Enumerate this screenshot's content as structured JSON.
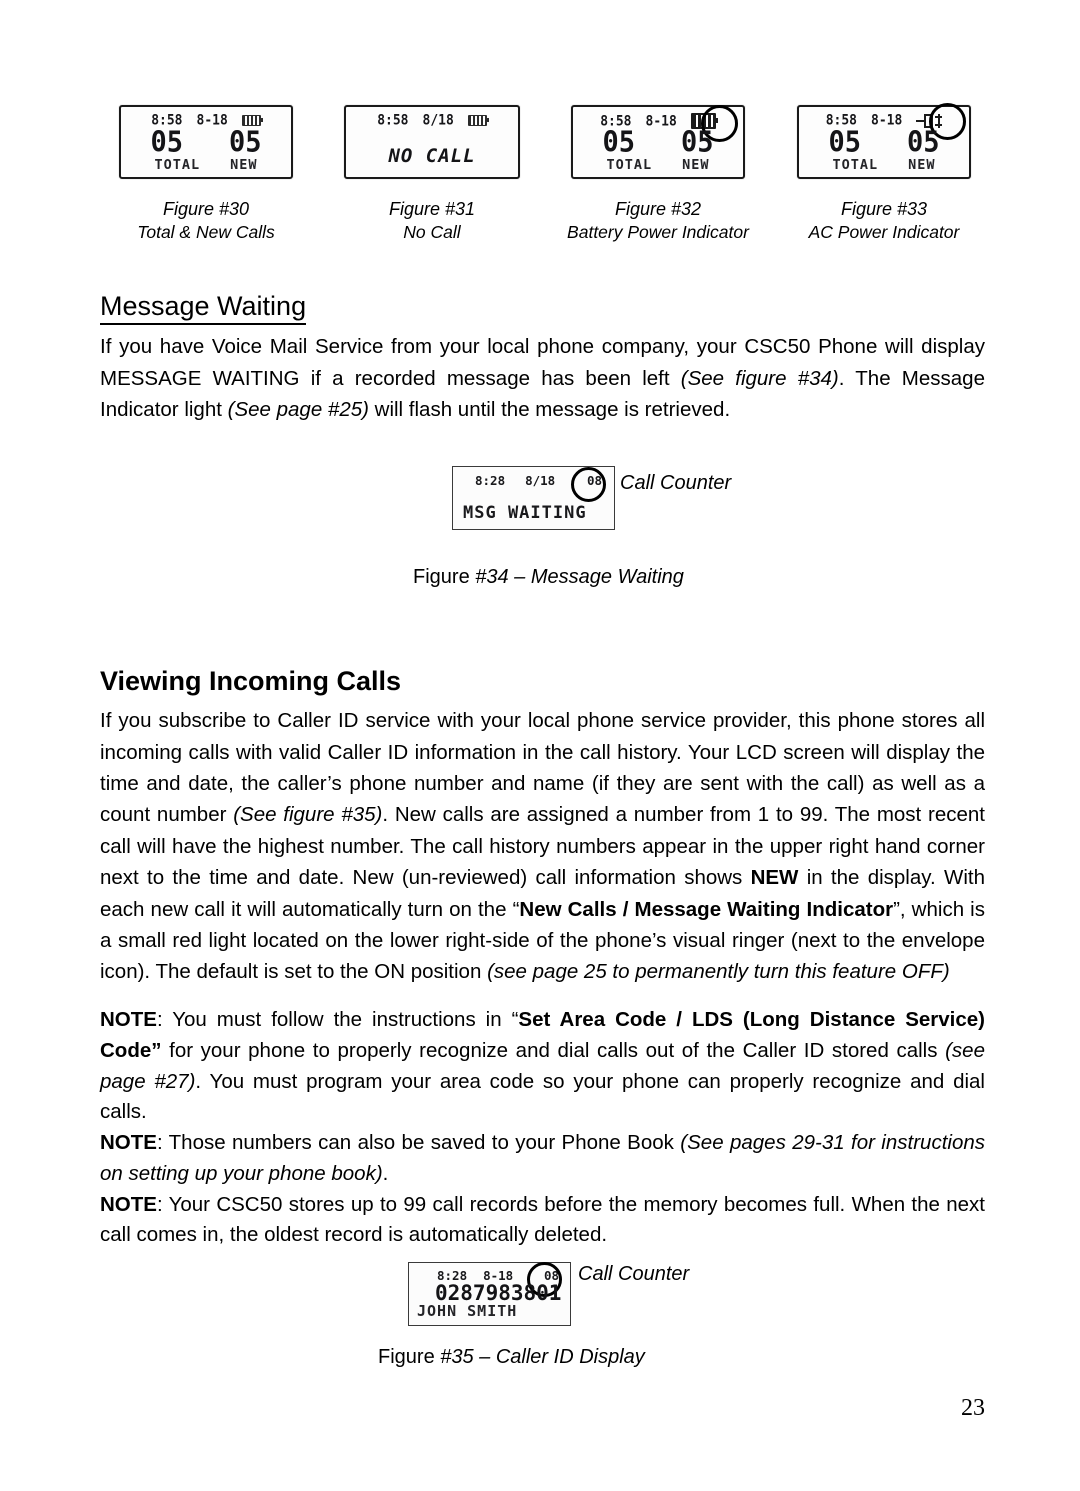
{
  "page": {
    "number": "23"
  },
  "figures_row": [
    {
      "lcd": {
        "time": "8:58",
        "date": "8-18",
        "indicator": "battery-mini-icon",
        "total_value": "05",
        "new_value": "05",
        "total_label": "TOTAL",
        "new_label": "NEW"
      },
      "caption_title": "Figure  #30",
      "caption_sub": "Total & New Calls"
    },
    {
      "lcd": {
        "time": "8:58",
        "date": "8/18",
        "indicator": "battery-mini-icon",
        "message": "NO CALL"
      },
      "caption_title": "Figure  #31",
      "caption_sub": "No Call"
    },
    {
      "lcd": {
        "time": "8:58",
        "date": "8-18",
        "indicator": "battery-icon-circled",
        "total_value": "05",
        "new_value": "05",
        "total_label": "TOTAL",
        "new_label": "NEW"
      },
      "caption_title": "Figure  #32",
      "caption_sub": "Battery Power Indicator"
    },
    {
      "lcd": {
        "time": "8:58",
        "date": "8-18",
        "indicator": "ac-plug-icon-circled",
        "total_value": "05",
        "new_value": "05",
        "total_label": "TOTAL",
        "new_label": "NEW"
      },
      "caption_title": "Figure  #33",
      "caption_sub": "AC Power Indicator"
    }
  ],
  "message_waiting": {
    "heading": "Message Waiting",
    "para_1": "If you have Voice Mail Service from your local phone company, your CSC50 Phone will display MESSAGE WAITING if a recorded message has been left ",
    "para_1_italic": "(See figure #34)",
    "para_1_b": ". The Message Indicator light ",
    "para_1_italic_2": "(See page #25)",
    "para_1_c": " will flash until the message is retrieved."
  },
  "figure34": {
    "lcd": {
      "time": "8:28",
      "date": "8/18",
      "call_counter": "08",
      "message": "MSG  WAITING"
    },
    "callout": "Call Counter",
    "caption_plain": "Figure  ",
    "caption_italic": "#34 – Message Waiting"
  },
  "viewing_incoming_calls": {
    "heading": "Viewing Incoming Calls",
    "p1_a": "If you subscribe to Caller ID service with your local phone service provider, this phone stores all incoming calls with valid Caller ID information in the call history. Your LCD screen will display the time and date, the caller’s phone number and name (if they are sent with the call) as well as a count number ",
    "p1_italic": "(See figure #35)",
    "p1_b": ". New calls are assigned a number from 1 to 99. The most recent call will have the highest number. The call history numbers appear in the upper right hand corner next to the time and date. New (un-reviewed) call information shows ",
    "p1_bold_new": "NEW",
    "p1_c": " in the display. With each new call it will automatically turn on the ",
    "p1_quote_open": "“",
    "p1_bold_indicator": "New Calls / Message Waiting Indicator",
    "p1_quote_close": "”",
    "p1_d": ", which is a small red light located on the lower right-side of the phone’s visual ringer (next to the envelope icon). The default is set to the ON position ",
    "p1_italic_2": "(see page 25 to permanently turn this feature OFF)"
  },
  "notes": {
    "note1_label": "NOTE",
    "note1_a": ": You must follow the instructions in ",
    "note1_quote_open": "“",
    "note1_bold": "Set Area Code / LDS (Long Distance Service) Code",
    "note1_quote_close": "”",
    "note1_b": " for your phone to properly recognize and dial calls out of the Caller ID stored calls ",
    "note1_italic": "(see page #27)",
    "note1_c": ". You must program your area code so your phone can properly recognize and dial calls.",
    "note2_label": "NOTE",
    "note2_a": ": Those numbers can also be saved to your Phone Book ",
    "note2_italic": "(See pages 29-31 for instructions on setting up your phone book)",
    "note2_b": ".",
    "note3_label": "NOTE",
    "note3_a": ": Your CSC50 stores up to 99 call records before the memory becomes full. When the next call comes in, the oldest record is automatically deleted."
  },
  "figure35": {
    "lcd": {
      "time": "8:28",
      "date": "8-18",
      "call_counter": "08",
      "phone_number": "0287983801",
      "caller_name": "JOHN SMITH"
    },
    "callout": "Call Counter",
    "caption_plain": "Figure ",
    "caption_italic": "#35 – Caller ID Display"
  }
}
